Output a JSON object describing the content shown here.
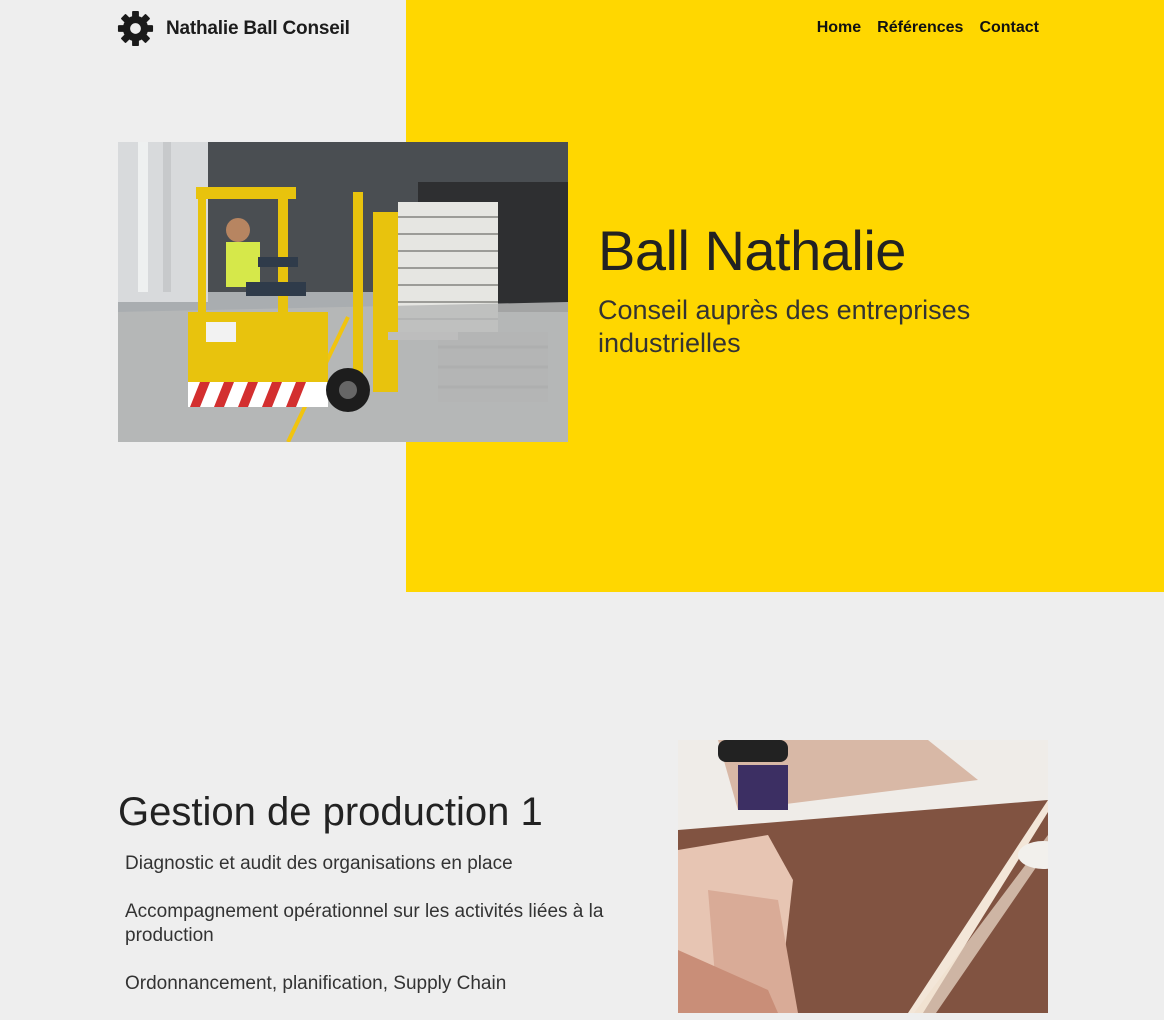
{
  "header": {
    "brand": "Nathalie Ball Conseil",
    "logo_icon": "gear-icon",
    "nav": [
      {
        "label": "Home"
      },
      {
        "label": "Références"
      },
      {
        "label": "Contact"
      }
    ]
  },
  "hero": {
    "title": "Ball Nathalie",
    "subtitle": "Conseil auprès des entreprises industrielles",
    "image": "forklift-warehouse-photo",
    "panel_color": "#ffd700"
  },
  "section": {
    "title": "Gestion de production 1",
    "items": [
      "Diagnostic et audit des organisations en place",
      "Accompagnement opérationnel sur les activités liées à la production",
      "Ordonnancement, planification, Supply Chain"
    ],
    "image": "hands-measuring-photo"
  },
  "colors": {
    "background": "#eeeeee",
    "accent": "#ffd700",
    "text": "#222222"
  }
}
